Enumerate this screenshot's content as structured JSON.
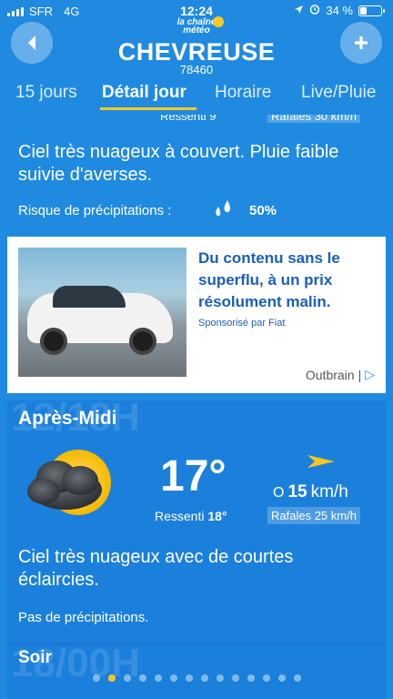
{
  "status": {
    "carrier": "SFR",
    "network": "4G",
    "time": "12:24",
    "battery_text": "34 %",
    "battery_level": 0.34
  },
  "header": {
    "back_icon": "chevron-left",
    "add_icon": "plus",
    "logo_text": "la chaîne météo",
    "city": "CHEVREUSE",
    "postcode": "78460"
  },
  "tabs": [
    {
      "label": "15 jours"
    },
    {
      "label": "Détail jour"
    },
    {
      "label": "Horaire"
    },
    {
      "label": "Live/Pluie"
    }
  ],
  "morning": {
    "ressenti_cut": "Ressenti 9",
    "rafales_cut": "Rafales 30 km/h",
    "description": "Ciel très nuageux à couvert. Pluie faible suivie d'averses.",
    "precip_label": "Risque de précipitations :",
    "precip_value": "50%"
  },
  "ad": {
    "headline": "Du contenu sans le superflu, à un prix résolument malin.",
    "sponsor": "Sponsorisé par Fiat",
    "network": "Outbrain",
    "adchoice": "▷"
  },
  "afternoon": {
    "ghost_time": "12/18H",
    "period": "Après-Midi",
    "temperature": "17°",
    "ressenti_label": "Ressenti",
    "ressenti_value": "18°",
    "wind_dir_symbol": "O",
    "wind_speed": "15",
    "wind_unit": "km/h",
    "rafales": "Rafales 25 km/h",
    "description": "Ciel très nuageux avec de courtes éclaircies.",
    "precip": "Pas de précipitations."
  },
  "evening": {
    "ghost_time": "18/00H",
    "period": "Soir"
  },
  "pager": {
    "count": 14,
    "active_index": 1
  },
  "colors": {
    "background": "#1f8ae0",
    "accent": "#ffc623"
  }
}
